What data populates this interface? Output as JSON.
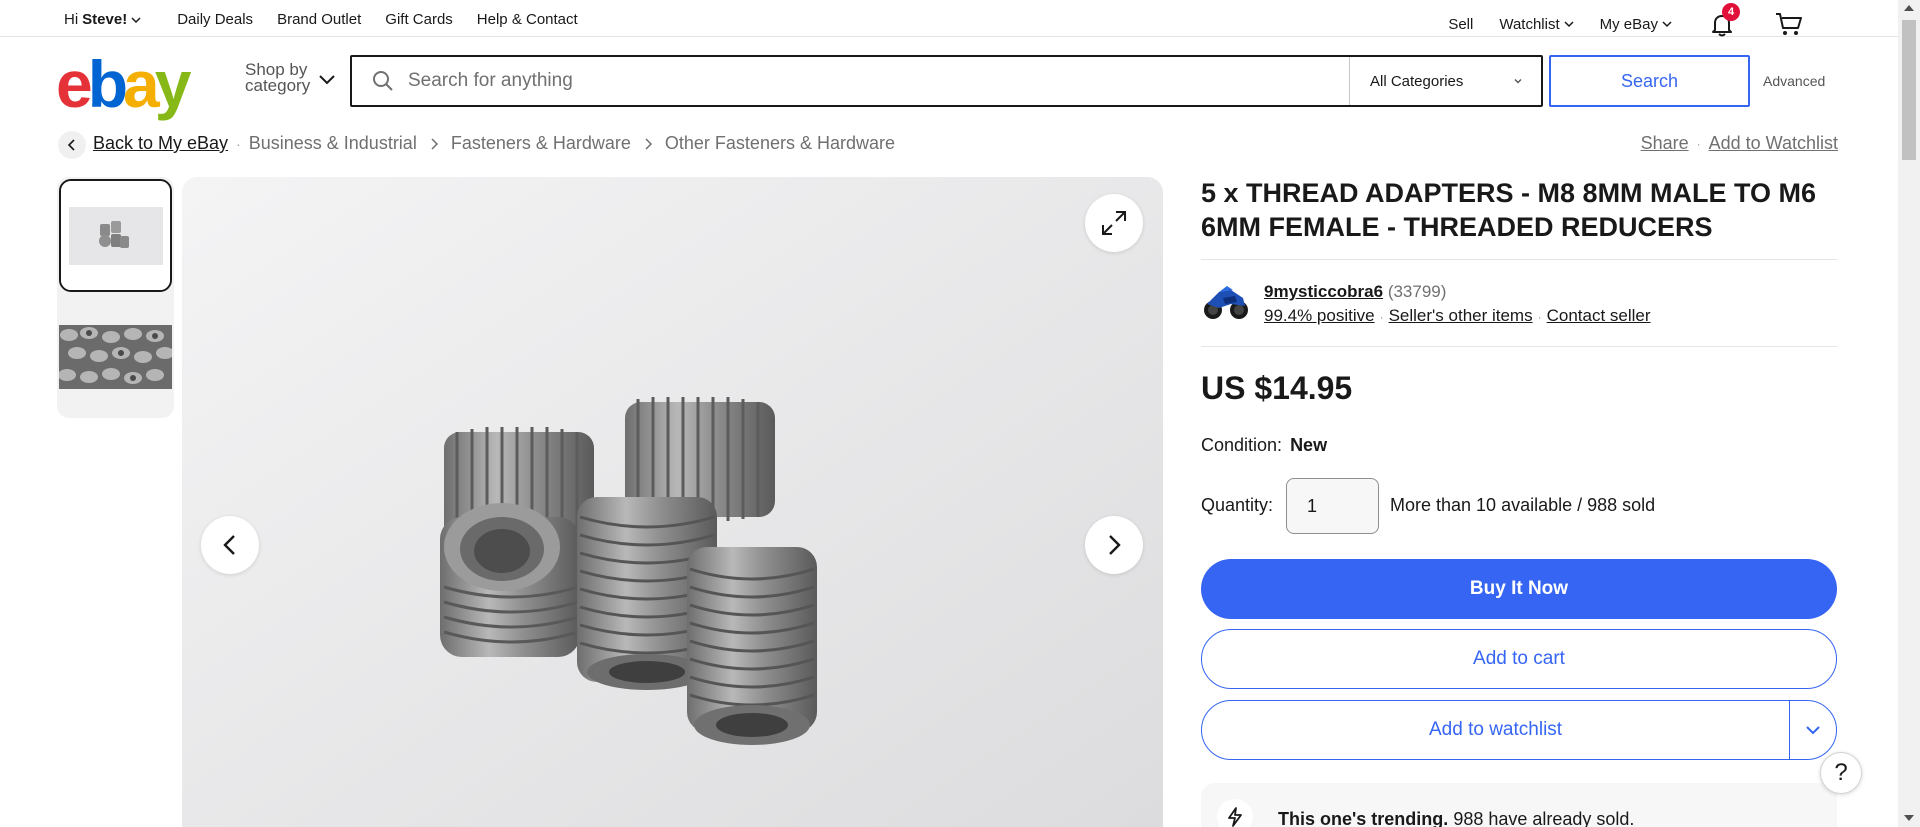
{
  "topbar": {
    "greeting_prefix": "Hi",
    "user_name": "Steve!",
    "links": [
      "Daily Deals",
      "Brand Outlet",
      "Gift Cards",
      "Help & Contact"
    ],
    "sell": "Sell",
    "watchlist": "Watchlist",
    "my_ebay": "My eBay",
    "notification_count": "4"
  },
  "header": {
    "logo_letters": [
      "e",
      "b",
      "a",
      "y"
    ],
    "shop_by": "Shop by category",
    "search_placeholder": "Search for anything",
    "category": "All Categories",
    "search_button": "Search",
    "advanced": "Advanced"
  },
  "breadcrumb": {
    "back": "Back to My eBay",
    "items": [
      "Business & Industrial",
      "Fasteners & Hardware",
      "Other Fasteners & Hardware"
    ],
    "share": "Share",
    "add_watchlist": "Add to Watchlist"
  },
  "listing": {
    "title": "5 x THREAD ADAPTERS - M8 8MM MALE TO M6 6MM FEMALE - THREADED REDUCERS",
    "seller_name": "9mysticcobra6",
    "seller_count": "(33799)",
    "seller_positive": "99.4% positive",
    "seller_other": "Seller's other items",
    "contact_seller": "Contact seller",
    "price": "US $14.95",
    "condition_label": "Condition:",
    "condition_value": "New",
    "quantity_label": "Quantity:",
    "quantity_value": "1",
    "availability": "More than 10 available / 988 sold",
    "buy_now": "Buy It Now",
    "add_to_cart": "Add to cart",
    "add_to_watchlist": "Add to watchlist",
    "trend_bold": "This one's trending.",
    "trend_rest": "988 have already sold."
  },
  "help": "?",
  "colors": {
    "accent": "#3665f3",
    "badge": "#e0103a",
    "logo_red": "#e53238",
    "logo_blue": "#0064d2",
    "logo_yellow": "#f5af02",
    "logo_green": "#86b817"
  }
}
